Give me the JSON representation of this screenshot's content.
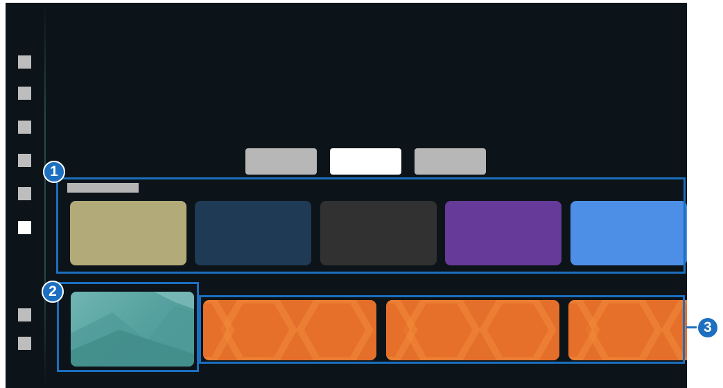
{
  "callouts": {
    "one": "1",
    "two": "2",
    "three": "3"
  },
  "colors": {
    "screen_bg": "#0d1419",
    "highlight": "#1b6fbf",
    "card_tan": "#b3aa7a",
    "card_navy": "#1f3a55",
    "card_dark": "#313131",
    "card_purple": "#663a98",
    "card_blue": "#4d8ee6",
    "card_orange": "#e46f2b",
    "preview_teal": "#5fa9a7"
  },
  "icons": {
    "nav": "placeholder-square-icon",
    "preview": "landscape-image-icon",
    "orange_card": "hexagon-pattern-icon"
  }
}
